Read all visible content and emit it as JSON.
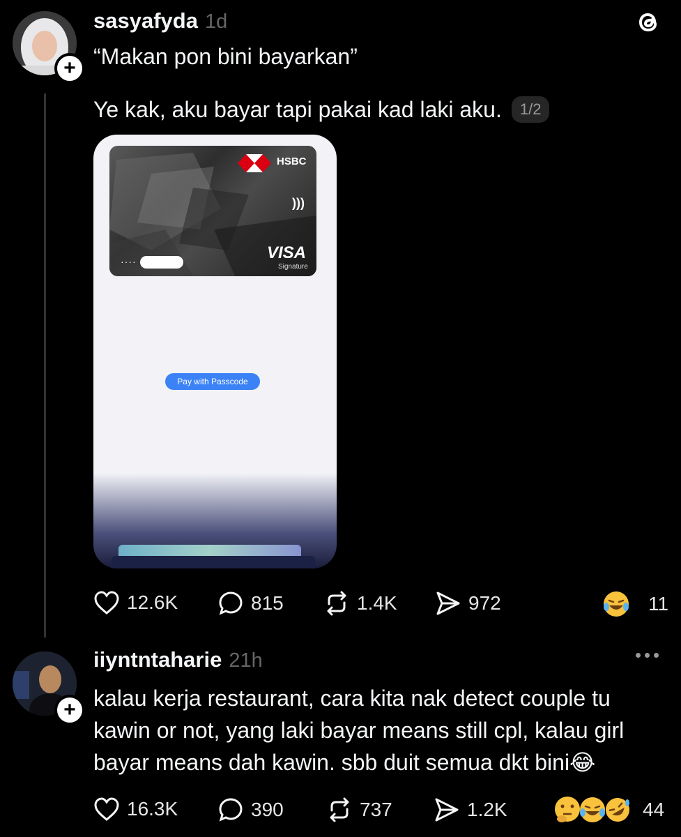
{
  "app": {
    "logo_icon": "threads-logo-icon"
  },
  "post1": {
    "username": "sasyafyda",
    "time": "1d",
    "quote": "“Makan pon bini bayarkan”",
    "text": "Ye kak, aku bayar tapi pakai kad laki aku.",
    "pager": "1/2",
    "card": {
      "bank": "HSBC",
      "network": "VISA",
      "tier": "Signature",
      "dots": "····"
    },
    "pay_button": "Pay with Passcode",
    "stats": {
      "likes": "12.6K",
      "comments": "815",
      "reposts": "1.4K",
      "shares": "972",
      "reactions": "11"
    }
  },
  "post2": {
    "username": "iiyntntaharie",
    "time": "21h",
    "lines": [
      "kalau kerja restaurant, cara kita nak detect couple tu",
      "kawin or not, yang laki bayar means still cpl, kalau girl",
      "bayar means dah kawin. sbb duit semua dkt bini😂"
    ],
    "stats": {
      "likes": "16.3K",
      "comments": "390",
      "reposts": "737",
      "shares": "1.2K",
      "reactions": "44"
    }
  },
  "colors": {
    "background": "#000000",
    "text": "#f3f5f7",
    "muted": "#666666",
    "accent_button": "#3b82f6"
  }
}
